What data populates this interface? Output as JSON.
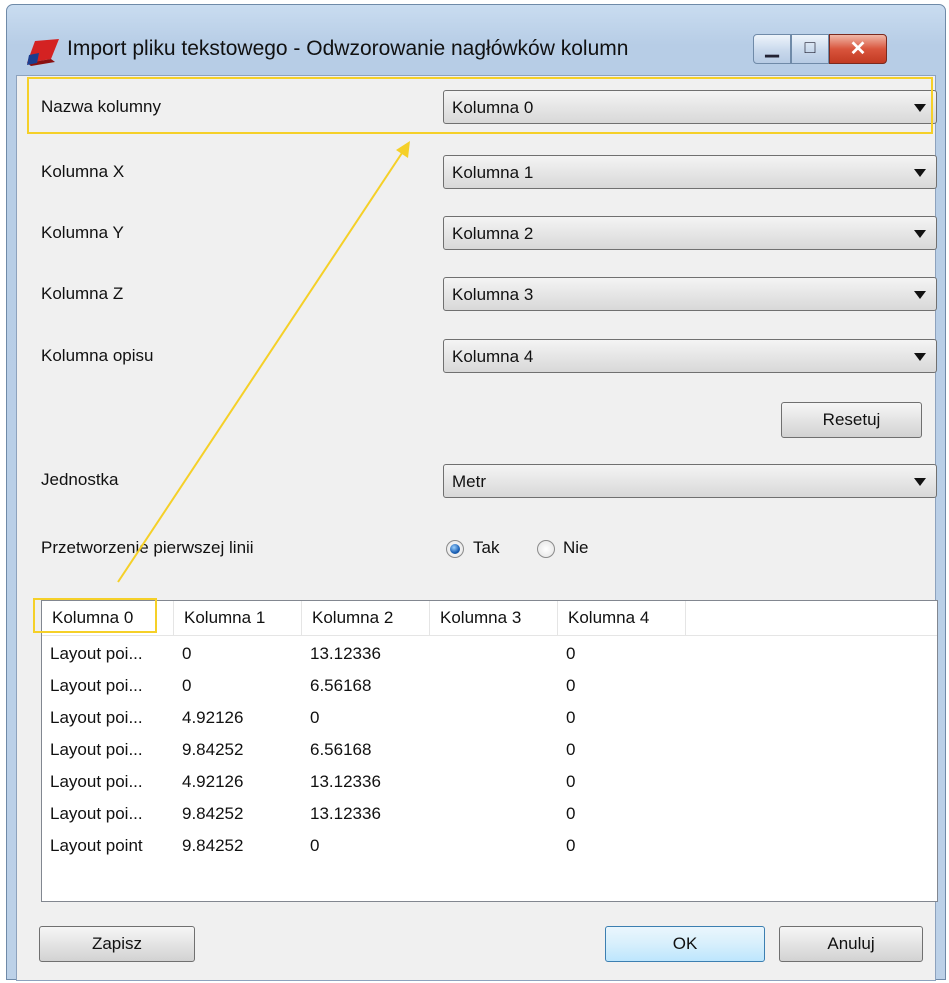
{
  "window": {
    "title": "Import pliku tekstowego - Odwzorowanie nagłówków kolumn",
    "minimize_glyph": "▁",
    "maximize_glyph": "□",
    "close_glyph": "✕"
  },
  "mapping": [
    {
      "label": "Nazwa kolumny",
      "value": "Kolumna 0"
    },
    {
      "label": "Kolumna X",
      "value": "Kolumna 1"
    },
    {
      "label": "Kolumna Y",
      "value": "Kolumna 2"
    },
    {
      "label": "Kolumna Z",
      "value": "Kolumna 3"
    },
    {
      "label": "Kolumna opisu",
      "value": "Kolumna 4"
    }
  ],
  "reset_button": "Resetuj",
  "unit": {
    "label": "Jednostka",
    "value": "Metr"
  },
  "first_line": {
    "label": "Przetworzenie pierwszej linii",
    "option_yes": "Tak",
    "option_no": "Nie",
    "selected": "Tak"
  },
  "grid": {
    "columns": [
      "Kolumna 0",
      "Kolumna 1",
      "Kolumna 2",
      "Kolumna 3",
      "Kolumna 4"
    ],
    "rows": [
      [
        "Layout poi...",
        "0",
        "13.12336",
        "",
        "0"
      ],
      [
        "Layout poi...",
        "0",
        "6.56168",
        "",
        "0"
      ],
      [
        "Layout poi...",
        "4.92126",
        "0",
        "",
        "0"
      ],
      [
        "Layout poi...",
        "9.84252",
        "6.56168",
        "",
        "0"
      ],
      [
        "Layout poi...",
        "4.92126",
        "13.12336",
        "",
        "0"
      ],
      [
        "Layout poi...",
        "9.84252",
        "13.12336",
        "",
        "0"
      ],
      [
        "Layout point",
        "9.84252",
        "0",
        "",
        "0"
      ]
    ]
  },
  "footer": {
    "save": "Zapisz",
    "ok": "OK",
    "cancel": "Anuluj"
  },
  "colors": {
    "highlight": "#f5d028",
    "close_button": "#c23a22",
    "title_bar": "#bcd1e8"
  }
}
